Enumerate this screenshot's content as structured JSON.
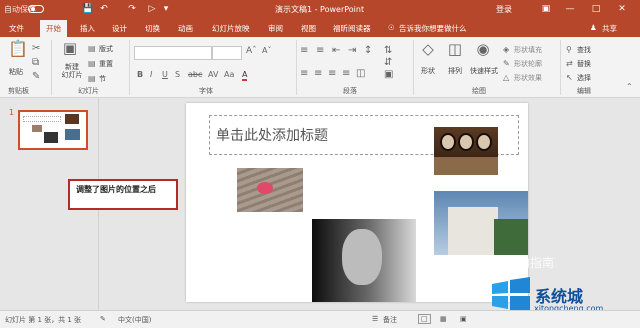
{
  "title_bar": {
    "autosave_label": "自动保存",
    "doc_title": "演示文稿1 - PowerPoint",
    "login_label": "登录"
  },
  "tabs": [
    "文件",
    "开始",
    "插入",
    "设计",
    "切换",
    "动画",
    "幻灯片放映",
    "审阅",
    "视图",
    "福昕阅读器"
  ],
  "tell_me": "告诉我你想要做什么",
  "share_label": "共享",
  "ribbon": {
    "clipboard": {
      "paste": "粘贴",
      "group": "剪贴板"
    },
    "slides": {
      "new_slide": "新建\n幻灯片",
      "layout": "版式",
      "reset": "重置",
      "section": "节",
      "group": "幻灯片"
    },
    "font": {
      "group": "字体"
    },
    "paragraph": {
      "group": "段落"
    },
    "drawing": {
      "shape": "形状",
      "arrange": "排列",
      "quick_styles": "快速样式",
      "fill": "形状填充",
      "outline": "形状轮廓",
      "effects": "形状效果",
      "group": "绘图"
    },
    "editing": {
      "find": "查找",
      "replace": "替换",
      "select": "选择",
      "group": "编辑"
    }
  },
  "slide_panel": {
    "slide_number": "1"
  },
  "slide": {
    "title_placeholder": "单击此处添加标题"
  },
  "callout": {
    "text": "调整了图片的位置之后"
  },
  "status_bar": {
    "slide_info": "幻灯片 第 1 张，共 1 张",
    "language": "中文(中国)",
    "notes": "备注"
  },
  "watermark": {
    "sougou": "搜狗指南",
    "brand": "系统城",
    "url": "xitongcheng.com"
  },
  "colors": {
    "accent": "#b7472a",
    "callout_border": "#b32a28"
  }
}
